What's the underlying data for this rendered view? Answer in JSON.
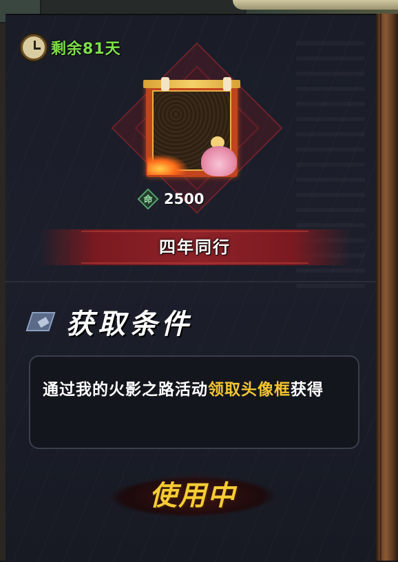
{
  "timer": {
    "icon": "clock-icon",
    "text": "剩余81天",
    "color": "#7ee04a"
  },
  "item": {
    "name": "四年同行",
    "price_icon": "ming-gem-icon",
    "price_icon_text": "命",
    "price": "2500"
  },
  "condition": {
    "title": "获取条件",
    "text_part1": "通过我的火影之路活动",
    "text_highlight": "领取头像框",
    "text_part2": "获得",
    "highlight_color": "#f4c532"
  },
  "action": {
    "label": "使用中"
  }
}
